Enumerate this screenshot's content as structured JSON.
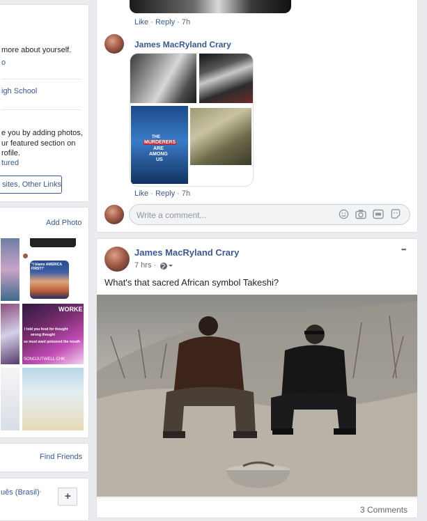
{
  "sidebar": {
    "intro_text": "more about yourself.",
    "intro_link": "o",
    "school": "igh School",
    "featured_line1": "e you by adding photos,",
    "featured_line2": "ur featured section on",
    "featured_line3": "rofile.",
    "featured_link": "tured",
    "websites_button": "sites, Other Links",
    "add_photo": "Add Photo",
    "find_friends": "Find Friends",
    "language": "uês (Brasil)",
    "language_sep": "·",
    "plus": "+",
    "photo_texts": {
      "trump_caption": "\"I blame AMERICA FIRST!\"",
      "worke": "WORKE",
      "told_you_1": "I told you food for thought",
      "told_you_2": "wrong thought",
      "told_you_3": "so must want poisoned the mouth",
      "chk": "SONOJUTWELL CHK"
    }
  },
  "top_comment": {
    "like": "Like",
    "reply": "Reply",
    "time": "7h",
    "dot": "·"
  },
  "collage_comment": {
    "author": "James MacRyland Crary",
    "like": "Like",
    "reply": "Reply",
    "time": "7h",
    "dot": "·",
    "poster_title_1": "THE",
    "poster_title_2": "MURDERERS",
    "poster_title_3": "ARE",
    "poster_title_4": "AMONG",
    "poster_title_5": "US"
  },
  "comment_box": {
    "placeholder": "Write a comment...",
    "icons": [
      "emoji-icon",
      "camera-icon",
      "gif-icon",
      "sticker-icon"
    ]
  },
  "post": {
    "author": "James MacRyland Crary",
    "time": "7 hrs",
    "dot": "·",
    "privacy": "public",
    "more": "•••",
    "text": "What's that sacred African symbol Takeshi?",
    "comments_count": "3 Comments"
  },
  "colors": {
    "link": "#385898",
    "background": "#e9ebee",
    "border": "#dddfe2"
  }
}
